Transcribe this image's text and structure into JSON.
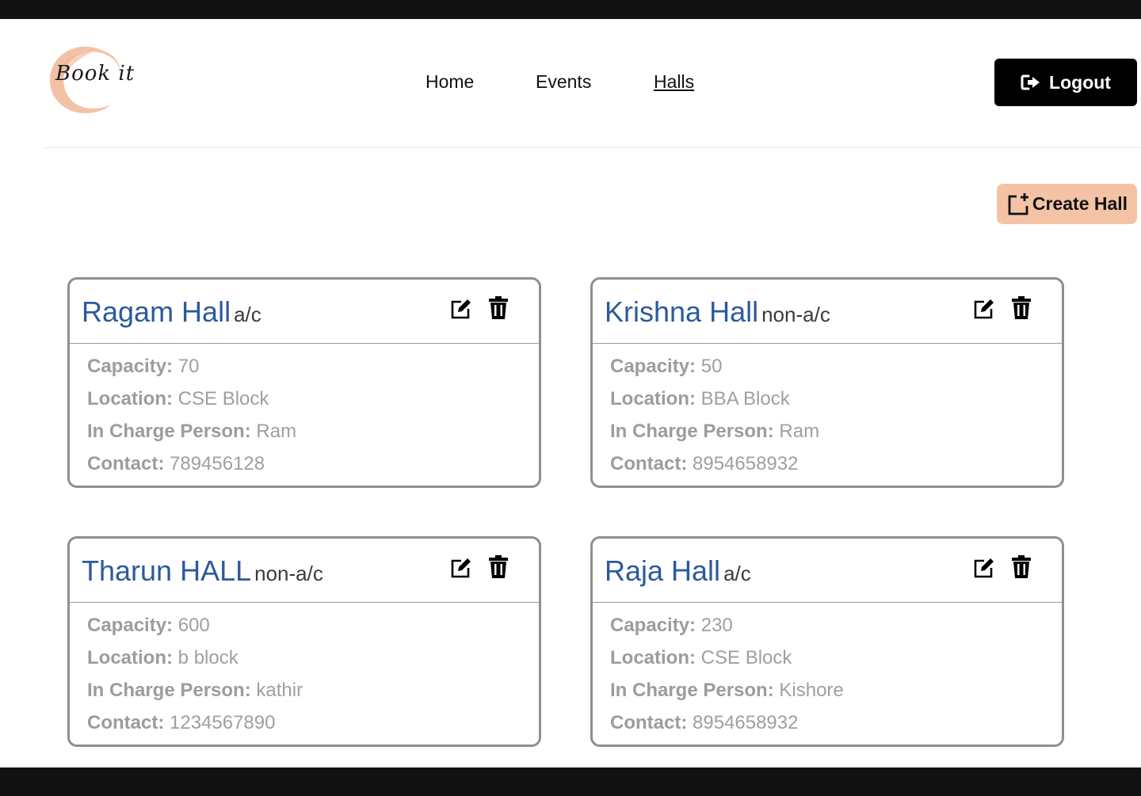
{
  "header": {
    "logo_text": "Book it",
    "nav": [
      {
        "label": "Home"
      },
      {
        "label": "Events"
      },
      {
        "label": "Halls"
      }
    ],
    "logout_label": "Logout"
  },
  "toolbar": {
    "create_label": "Create Hall"
  },
  "labels": {
    "capacity": "Capacity:",
    "location": "Location:",
    "in_charge": "In Charge Person:",
    "contact": "Contact:"
  },
  "halls": [
    {
      "name": "Ragam Hall",
      "type": "a/c",
      "capacity": "70",
      "location": "CSE Block",
      "in_charge": "Ram",
      "contact": "789456128"
    },
    {
      "name": "Krishna Hall",
      "type": "non-a/c",
      "capacity": "50",
      "location": "BBA Block",
      "in_charge": "Ram",
      "contact": "8954658932"
    },
    {
      "name": "Tharun HALL",
      "type": "non-a/c",
      "capacity": "600",
      "location": "b block",
      "in_charge": "kathir",
      "contact": "1234567890"
    },
    {
      "name": "Raja Hall",
      "type": "a/c",
      "capacity": "230",
      "location": "CSE Block",
      "in_charge": "Kishore",
      "contact": "8954658932"
    }
  ],
  "colors": {
    "accent": "#f4c3a6",
    "title_blue": "#2c5a9c",
    "muted_text": "#a09f9b",
    "dark": "#000000"
  }
}
